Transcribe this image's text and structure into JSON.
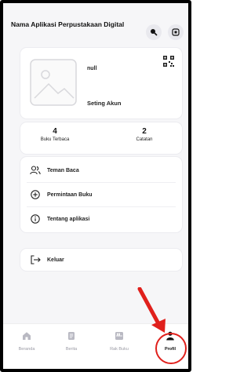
{
  "app": {
    "title": "Nama Aplikasi Perpustakaan Digital"
  },
  "header": {
    "search_icon": "search-icon",
    "qr_icon": "qr-scan-icon"
  },
  "profile": {
    "name": "null",
    "setting_label": "Seting Akun",
    "avatar_placeholder_icon": "image-placeholder-icon",
    "qr_icon": "qr-code-icon"
  },
  "stats": [
    {
      "value": "4",
      "label": "Buku Terbaca"
    },
    {
      "value": "2",
      "label": "Catatan"
    }
  ],
  "menu": [
    {
      "label": "Teman Baca",
      "icon": "users-icon"
    },
    {
      "label": "Permintaan Buku",
      "icon": "plus-circle-icon"
    },
    {
      "label": "Tentang aplikasi",
      "icon": "info-icon"
    }
  ],
  "logout": {
    "label": "Keluar",
    "icon": "logout-icon"
  },
  "bottom_nav": [
    {
      "label": "Beranda",
      "icon": "home-icon",
      "active": false
    },
    {
      "label": "Berita",
      "icon": "news-icon",
      "active": false
    },
    {
      "label": "Rak Buku",
      "icon": "bookshelf-icon",
      "active": false
    },
    {
      "label": "Profil",
      "icon": "person-icon",
      "active": true
    }
  ],
  "colors": {
    "annotation_red": "#e0201c",
    "active_nav": "#111111",
    "inactive_nav": "#9a9aa4"
  }
}
